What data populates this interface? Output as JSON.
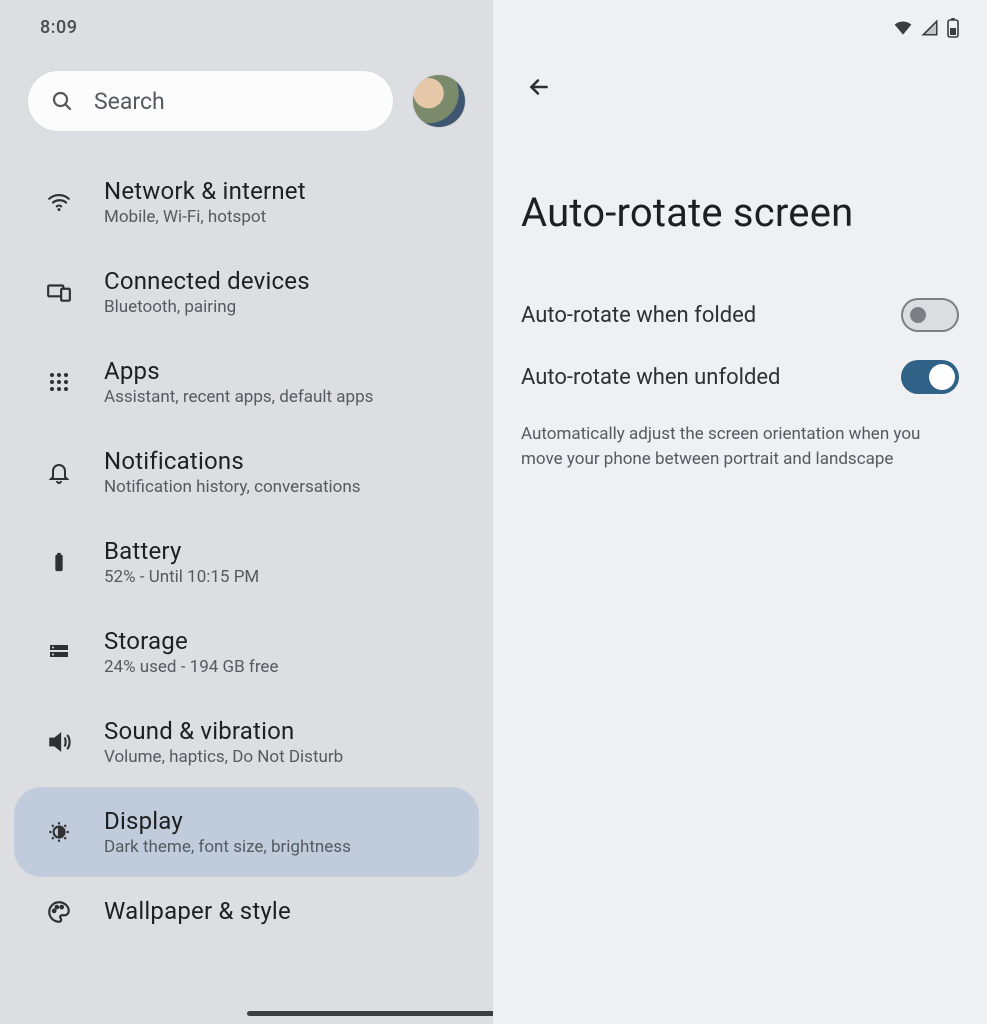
{
  "statusbar": {
    "time": "8:09"
  },
  "search": {
    "placeholder": "Search"
  },
  "sidebar": {
    "items": [
      {
        "id": "network",
        "title": "Network & internet",
        "subtitle": "Mobile, Wi-Fi, hotspot"
      },
      {
        "id": "connected",
        "title": "Connected devices",
        "subtitle": "Bluetooth, pairing"
      },
      {
        "id": "apps",
        "title": "Apps",
        "subtitle": "Assistant, recent apps, default apps"
      },
      {
        "id": "notifications",
        "title": "Notifications",
        "subtitle": "Notification history, conversations"
      },
      {
        "id": "battery",
        "title": "Battery",
        "subtitle": "52% - Until 10:15 PM"
      },
      {
        "id": "storage",
        "title": "Storage",
        "subtitle": "24% used - 194 GB free"
      },
      {
        "id": "sound",
        "title": "Sound & vibration",
        "subtitle": "Volume, haptics, Do Not Disturb"
      },
      {
        "id": "display",
        "title": "Display",
        "subtitle": "Dark theme, font size, brightness",
        "selected": true
      },
      {
        "id": "wallpaper",
        "title": "Wallpaper & style",
        "subtitle": ""
      }
    ]
  },
  "detail": {
    "page_title": "Auto-rotate screen",
    "rows": [
      {
        "id": "folded",
        "label": "Auto-rotate when folded",
        "value": false
      },
      {
        "id": "unfolded",
        "label": "Auto-rotate when unfolded",
        "value": true
      }
    ],
    "helper": "Automatically adjust the screen orientation when you move your phone between portrait and landscape"
  }
}
